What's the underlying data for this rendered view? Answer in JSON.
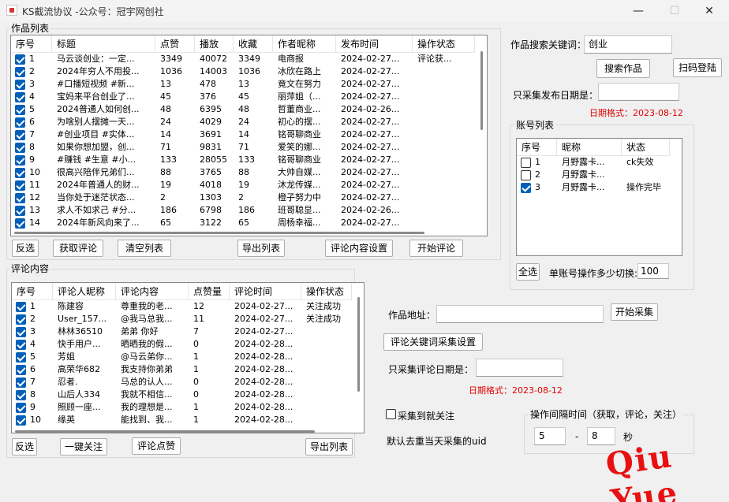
{
  "window": {
    "title": "KS截流协议 -公众号：冠宇网创社",
    "minimize": "—",
    "maximize": "☐",
    "close": "✕"
  },
  "works": {
    "group_title": "作品列表",
    "columns": [
      "序号",
      "标题",
      "点赞",
      "播放",
      "收藏",
      "作者昵称",
      "发布时间",
      "操作状态"
    ],
    "rows": [
      {
        "no": "1",
        "title": "马云谈创业：一定...",
        "likes": "3349",
        "plays": "40072",
        "fav": "3349",
        "author": "电商报",
        "time": "2024-02-27...",
        "status": "评论获..."
      },
      {
        "no": "2",
        "title": "2024年穷人不用投...",
        "likes": "1036",
        "plays": "14003",
        "fav": "1036",
        "author": "冰欣在路上",
        "time": "2024-02-27...",
        "status": ""
      },
      {
        "no": "3",
        "title": "#口播短视频 #新...",
        "likes": "13",
        "plays": "478",
        "fav": "13",
        "author": "竟文在努力",
        "time": "2024-02-27...",
        "status": ""
      },
      {
        "no": "4",
        "title": "宝妈来平台创业了...",
        "likes": "45",
        "plays": "376",
        "fav": "45",
        "author": "丽萍姐（...",
        "time": "2024-02-27...",
        "status": ""
      },
      {
        "no": "5",
        "title": "2024普通人如何创...",
        "likes": "48",
        "plays": "6395",
        "fav": "48",
        "author": "哲董商业...",
        "time": "2024-02-26...",
        "status": ""
      },
      {
        "no": "6",
        "title": "为啥别人摆摊一天...",
        "likes": "24",
        "plays": "4029",
        "fav": "24",
        "author": "初心的摆...",
        "time": "2024-02-27...",
        "status": ""
      },
      {
        "no": "7",
        "title": "#创业项目 #实体...",
        "likes": "14",
        "plays": "3691",
        "fav": "14",
        "author": "铭哥聊商业",
        "time": "2024-02-27...",
        "status": ""
      },
      {
        "no": "8",
        "title": "如果你想加盟，创...",
        "likes": "71",
        "plays": "9831",
        "fav": "71",
        "author": "爱笑的娜...",
        "time": "2024-02-27...",
        "status": ""
      },
      {
        "no": "9",
        "title": "#赚钱 #生意 #小...",
        "likes": "133",
        "plays": "28055",
        "fav": "133",
        "author": "铭哥聊商业",
        "time": "2024-02-27...",
        "status": ""
      },
      {
        "no": "10",
        "title": "很高兴陪伴兄弟们...",
        "likes": "88",
        "plays": "3765",
        "fav": "88",
        "author": "大帅自媒...",
        "time": "2024-02-27...",
        "status": ""
      },
      {
        "no": "11",
        "title": "2024年普通人的财...",
        "likes": "19",
        "plays": "4018",
        "fav": "19",
        "author": "沐龙传媒...",
        "time": "2024-02-27...",
        "status": ""
      },
      {
        "no": "12",
        "title": "当你处于迷茫状态...",
        "likes": "2",
        "plays": "1303",
        "fav": "2",
        "author": "橙子努力中",
        "time": "2024-02-27...",
        "status": ""
      },
      {
        "no": "13",
        "title": "求人不如求己 #分...",
        "likes": "186",
        "plays": "6798",
        "fav": "186",
        "author": "班哥聪显...",
        "time": "2024-02-26...",
        "status": ""
      },
      {
        "no": "14",
        "title": "2024年新风向来了...",
        "likes": "65",
        "plays": "3122",
        "fav": "65",
        "author": "周杨幸福...",
        "time": "2024-02-27...",
        "status": ""
      }
    ],
    "buttons": {
      "invert": "反选",
      "fetch_comments": "获取评论",
      "clear": "清空列表",
      "export": "导出列表",
      "comment_settings": "评论内容设置",
      "start_comment": "开始评论"
    }
  },
  "search": {
    "keyword_label": "作品搜索关键词：",
    "keyword_value": "创业",
    "search_button": "搜索作品",
    "login_button": "扫码登陆",
    "date_label": "只采集发布日期是：",
    "date_value": "",
    "date_format": "日期格式：2023-08-12"
  },
  "accounts": {
    "group_title": "账号列表",
    "columns": [
      "序号",
      "昵称",
      "状态"
    ],
    "rows": [
      {
        "no": "1",
        "nick": "月野露卡...",
        "status": "ck失效",
        "checked": false
      },
      {
        "no": "2",
        "nick": "月野露卡...",
        "status": "",
        "checked": false
      },
      {
        "no": "3",
        "nick": "月野露卡...",
        "status": "操作完毕",
        "checked": true
      }
    ],
    "select_all": "全选",
    "switch_label": "单账号操作多少切换:",
    "switch_value": "100"
  },
  "comments": {
    "group_title": "评论内容",
    "columns": [
      "序号",
      "评论人昵称",
      "评论内容",
      "点赞量",
      "评论时间",
      "操作状态"
    ],
    "rows": [
      {
        "no": "1",
        "nick": "陈建容",
        "content": "尊重我的老...",
        "likes": "12",
        "time": "2024-02-27...",
        "status": "关注成功"
      },
      {
        "no": "2",
        "nick": "User_157...",
        "content": "@我马总我...",
        "likes": "11",
        "time": "2024-02-27...",
        "status": "关注成功"
      },
      {
        "no": "3",
        "nick": "林林36510",
        "content": "弟弟 你好",
        "likes": "7",
        "time": "2024-02-27...",
        "status": ""
      },
      {
        "no": "4",
        "nick": "快手用户...",
        "content": "晒晒我的假...",
        "likes": "0",
        "time": "2024-02-28...",
        "status": ""
      },
      {
        "no": "5",
        "nick": "芳姐",
        "content": "@马云弟你...",
        "likes": "1",
        "time": "2024-02-28...",
        "status": ""
      },
      {
        "no": "6",
        "nick": "高荣华682",
        "content": "我支持你弟弟",
        "likes": "1",
        "time": "2024-02-28...",
        "status": ""
      },
      {
        "no": "7",
        "nick": "忍者.",
        "content": "马总的认人...",
        "likes": "0",
        "time": "2024-02-28...",
        "status": ""
      },
      {
        "no": "8",
        "nick": "山后人334",
        "content": "我就不相信...",
        "likes": "0",
        "time": "2024-02-28...",
        "status": ""
      },
      {
        "no": "9",
        "nick": "照顾一座...",
        "content": "我的理想是...",
        "likes": "1",
        "time": "2024-02-28...",
        "status": ""
      },
      {
        "no": "10",
        "nick": "缘英",
        "content": "能找到、我...",
        "likes": "1",
        "time": "2024-02-28...",
        "status": ""
      }
    ],
    "buttons": {
      "invert": "反选",
      "follow_all": "一键关注",
      "like_comment": "评论点赞",
      "export": "导出列表"
    }
  },
  "collect": {
    "url_label": "作品地址：",
    "url_value": "",
    "start_button": "开始采集",
    "keyword_settings": "评论关键词采集设置",
    "date_label": "只采集评论日期是：",
    "date_value": "",
    "date_format": "日期格式：2023-08-12",
    "follow_on_collect": "采集到就关注",
    "dedupe_note": "默认去重当天采集的uid",
    "interval_title": "操作间隔时间（获取，评论，关注）",
    "interval_from": "5",
    "interval_dash": "-",
    "interval_to": "8",
    "interval_unit": "秒"
  },
  "watermark": "Qiu Yue"
}
